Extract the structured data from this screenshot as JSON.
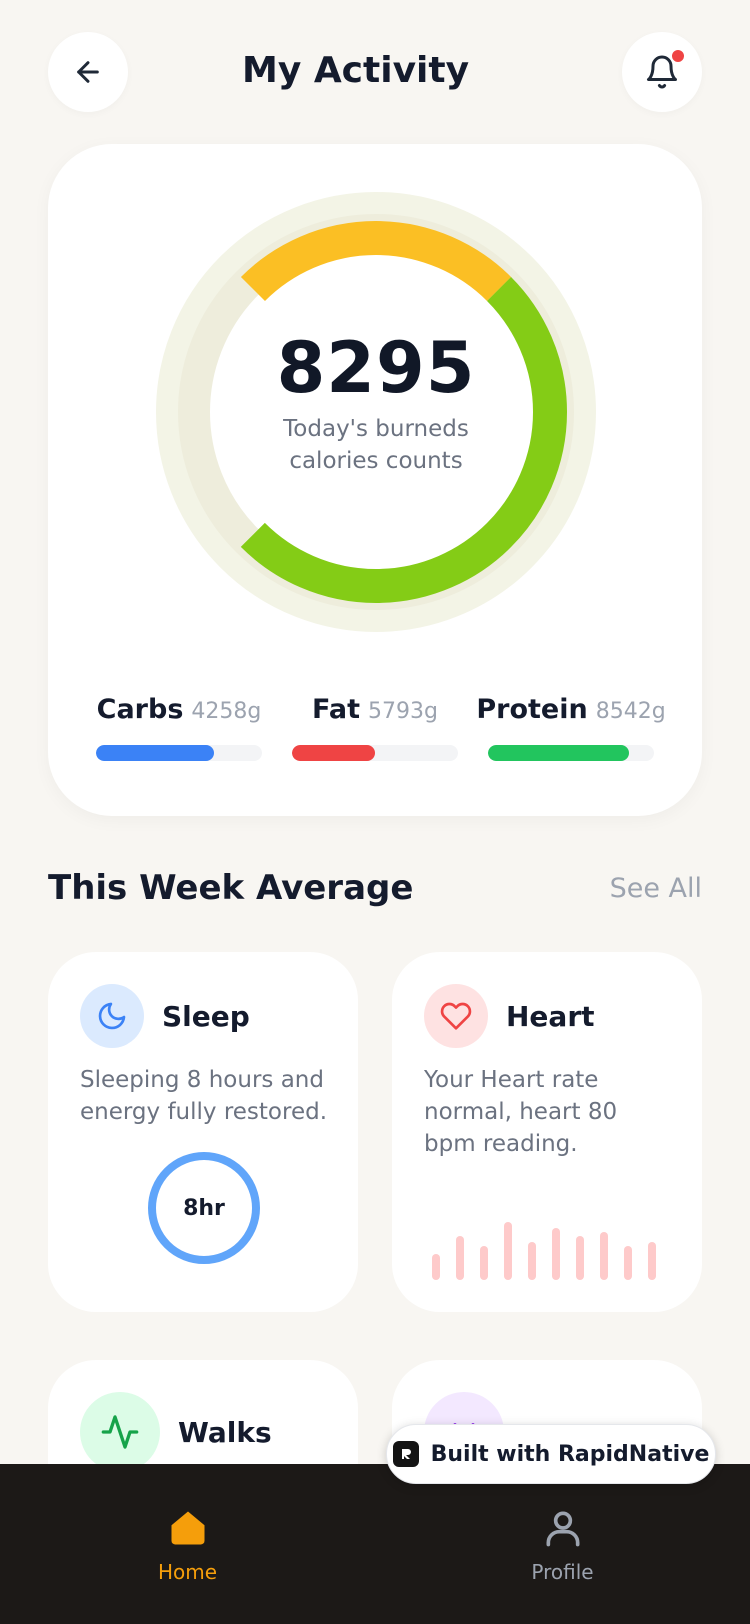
{
  "header": {
    "title": "My Activity"
  },
  "summary": {
    "calories": "8295",
    "caption": "Today's burneds calories counts",
    "ring": {
      "yellow_fraction": 0.25,
      "green_fraction": 0.5
    }
  },
  "macros": [
    {
      "name": "Carbs",
      "value": "4258g",
      "fill_fraction": 0.71,
      "color": "#3B82F6"
    },
    {
      "name": "Fat",
      "value": "5793g",
      "fill_fraction": 0.5,
      "color": "#EF4444"
    },
    {
      "name": "Protein",
      "value": "8542g",
      "fill_fraction": 0.85,
      "color": "#22C55E"
    }
  ],
  "section": {
    "title": "This Week Average",
    "see_all": "See All"
  },
  "cards": {
    "sleep": {
      "title": "Sleep",
      "description": "Sleeping 8 hours and energy fully restored.",
      "ring_label": "8hr",
      "icon": "moon-icon"
    },
    "heart": {
      "title": "Heart",
      "description": "Your Heart rate normal, heart 80 bpm reading.",
      "icon": "heart-icon",
      "bars": [
        26,
        44,
        34,
        58,
        38,
        52,
        44,
        48,
        34,
        38
      ]
    },
    "walks": {
      "title": "Walks",
      "icon": "activity-icon"
    },
    "fourth": {
      "icon": "dumbbell-icon"
    }
  },
  "badge": {
    "text": "Built with RapidNative"
  },
  "tabbar": [
    {
      "label": "Home",
      "icon": "home-icon",
      "active": true
    },
    {
      "label": "Profile",
      "icon": "user-icon",
      "active": false
    }
  ]
}
